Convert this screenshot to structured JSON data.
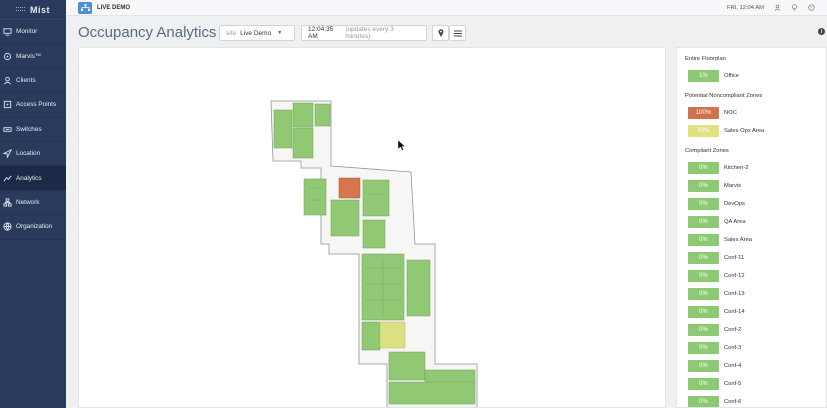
{
  "brand": {
    "name": "Mist"
  },
  "sidebar": {
    "items": [
      {
        "label": "Monitor",
        "icon": "monitor-icon"
      },
      {
        "label": "Marvis™",
        "icon": "marvis-icon"
      },
      {
        "label": "Clients",
        "icon": "clients-icon"
      },
      {
        "label": "Access Points",
        "icon": "access-point-icon"
      },
      {
        "label": "Switches",
        "icon": "switch-icon"
      },
      {
        "label": "Location",
        "icon": "location-icon"
      },
      {
        "label": "Analytics",
        "icon": "analytics-icon",
        "active": true
      },
      {
        "label": "Network",
        "icon": "network-icon"
      },
      {
        "label": "Organization",
        "icon": "organization-icon"
      }
    ]
  },
  "topbar": {
    "org": "LIVE DEMO",
    "time": "FRI, 12:04 AM"
  },
  "header": {
    "title": "Occupancy Analytics",
    "site_prefix": "site",
    "site_value": "Live Demo",
    "time_value": "12:04:35 AM",
    "time_note": "(updates every 3 minutes)"
  },
  "zones": {
    "entire_title": "Entire Floorplan",
    "entire": [
      {
        "value": "1%",
        "name": "Office",
        "level": "green"
      }
    ],
    "noncompliant_title": "Potential Noncompliant Zones",
    "noncompliant": [
      {
        "value": "100%",
        "name": "NOC",
        "level": "orange"
      },
      {
        "value": "50%",
        "name": "Sales Ops Area",
        "level": "yellow"
      }
    ],
    "compliant_title": "Compliant Zones",
    "compliant": [
      {
        "value": "0%",
        "name": "Kitchen-2",
        "level": "green"
      },
      {
        "value": "0%",
        "name": "Marvis",
        "level": "green"
      },
      {
        "value": "0%",
        "name": "DevOps",
        "level": "green"
      },
      {
        "value": "0%",
        "name": "QA Area",
        "level": "green"
      },
      {
        "value": "0%",
        "name": "Sales Area",
        "level": "green"
      },
      {
        "value": "0%",
        "name": "Conf-11",
        "level": "green"
      },
      {
        "value": "0%",
        "name": "Conf-12",
        "level": "green"
      },
      {
        "value": "0%",
        "name": "Conf-13",
        "level": "green"
      },
      {
        "value": "0%",
        "name": "Conf-14",
        "level": "green"
      },
      {
        "value": "0%",
        "name": "Conf-2",
        "level": "green"
      },
      {
        "value": "0%",
        "name": "Conf-3",
        "level": "green"
      },
      {
        "value": "0%",
        "name": "Conf-4",
        "level": "green"
      },
      {
        "value": "0%",
        "name": "Conf-5",
        "level": "green"
      },
      {
        "value": "0%",
        "name": "Conf-6",
        "level": "green"
      }
    ]
  },
  "colors": {
    "green": "#8dc973",
    "orange": "#d1714d",
    "yellow": "#dfe27e",
    "sidebar": "#2a3a5c"
  }
}
